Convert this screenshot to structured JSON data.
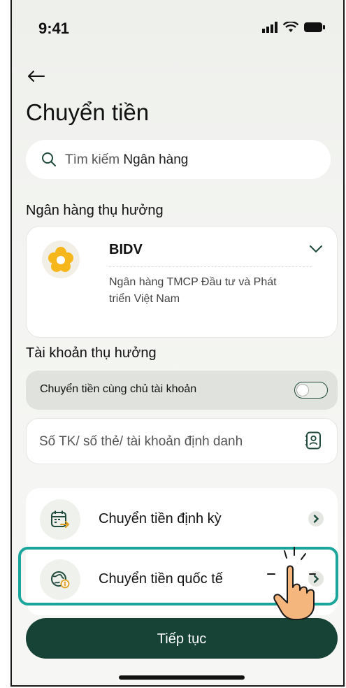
{
  "status_bar": {
    "time": "9:41"
  },
  "header": {
    "title": "Chuyển tiền"
  },
  "search": {
    "prefix": "Tìm kiếm",
    "keyword": "Ngân hàng"
  },
  "beneficiary_bank": {
    "section_label": "Ngân hàng thụ hưởng",
    "short_name": "BIDV",
    "full_name": "Ngân hàng TMCP Đầu tư và Phát triển Việt Nam"
  },
  "beneficiary_account": {
    "section_label": "Tài khoản thụ hưởng",
    "same_owner_label": "Chuyển tiền cùng chủ tài khoản",
    "same_owner_enabled": false,
    "account_placeholder": "Số TK/ số thẻ/ tài khoản định danh"
  },
  "menu": {
    "items": [
      {
        "label": "Chuyển tiền định kỳ",
        "icon": "calendar-transfer-icon"
      },
      {
        "label": "Chuyển tiền quốc tế",
        "icon": "globe-exchange-icon"
      }
    ]
  },
  "actions": {
    "continue_label": "Tiếp tục"
  },
  "colors": {
    "primary": "#174336",
    "highlight": "#1aa69a",
    "bank_logo": "#f5b71c"
  }
}
